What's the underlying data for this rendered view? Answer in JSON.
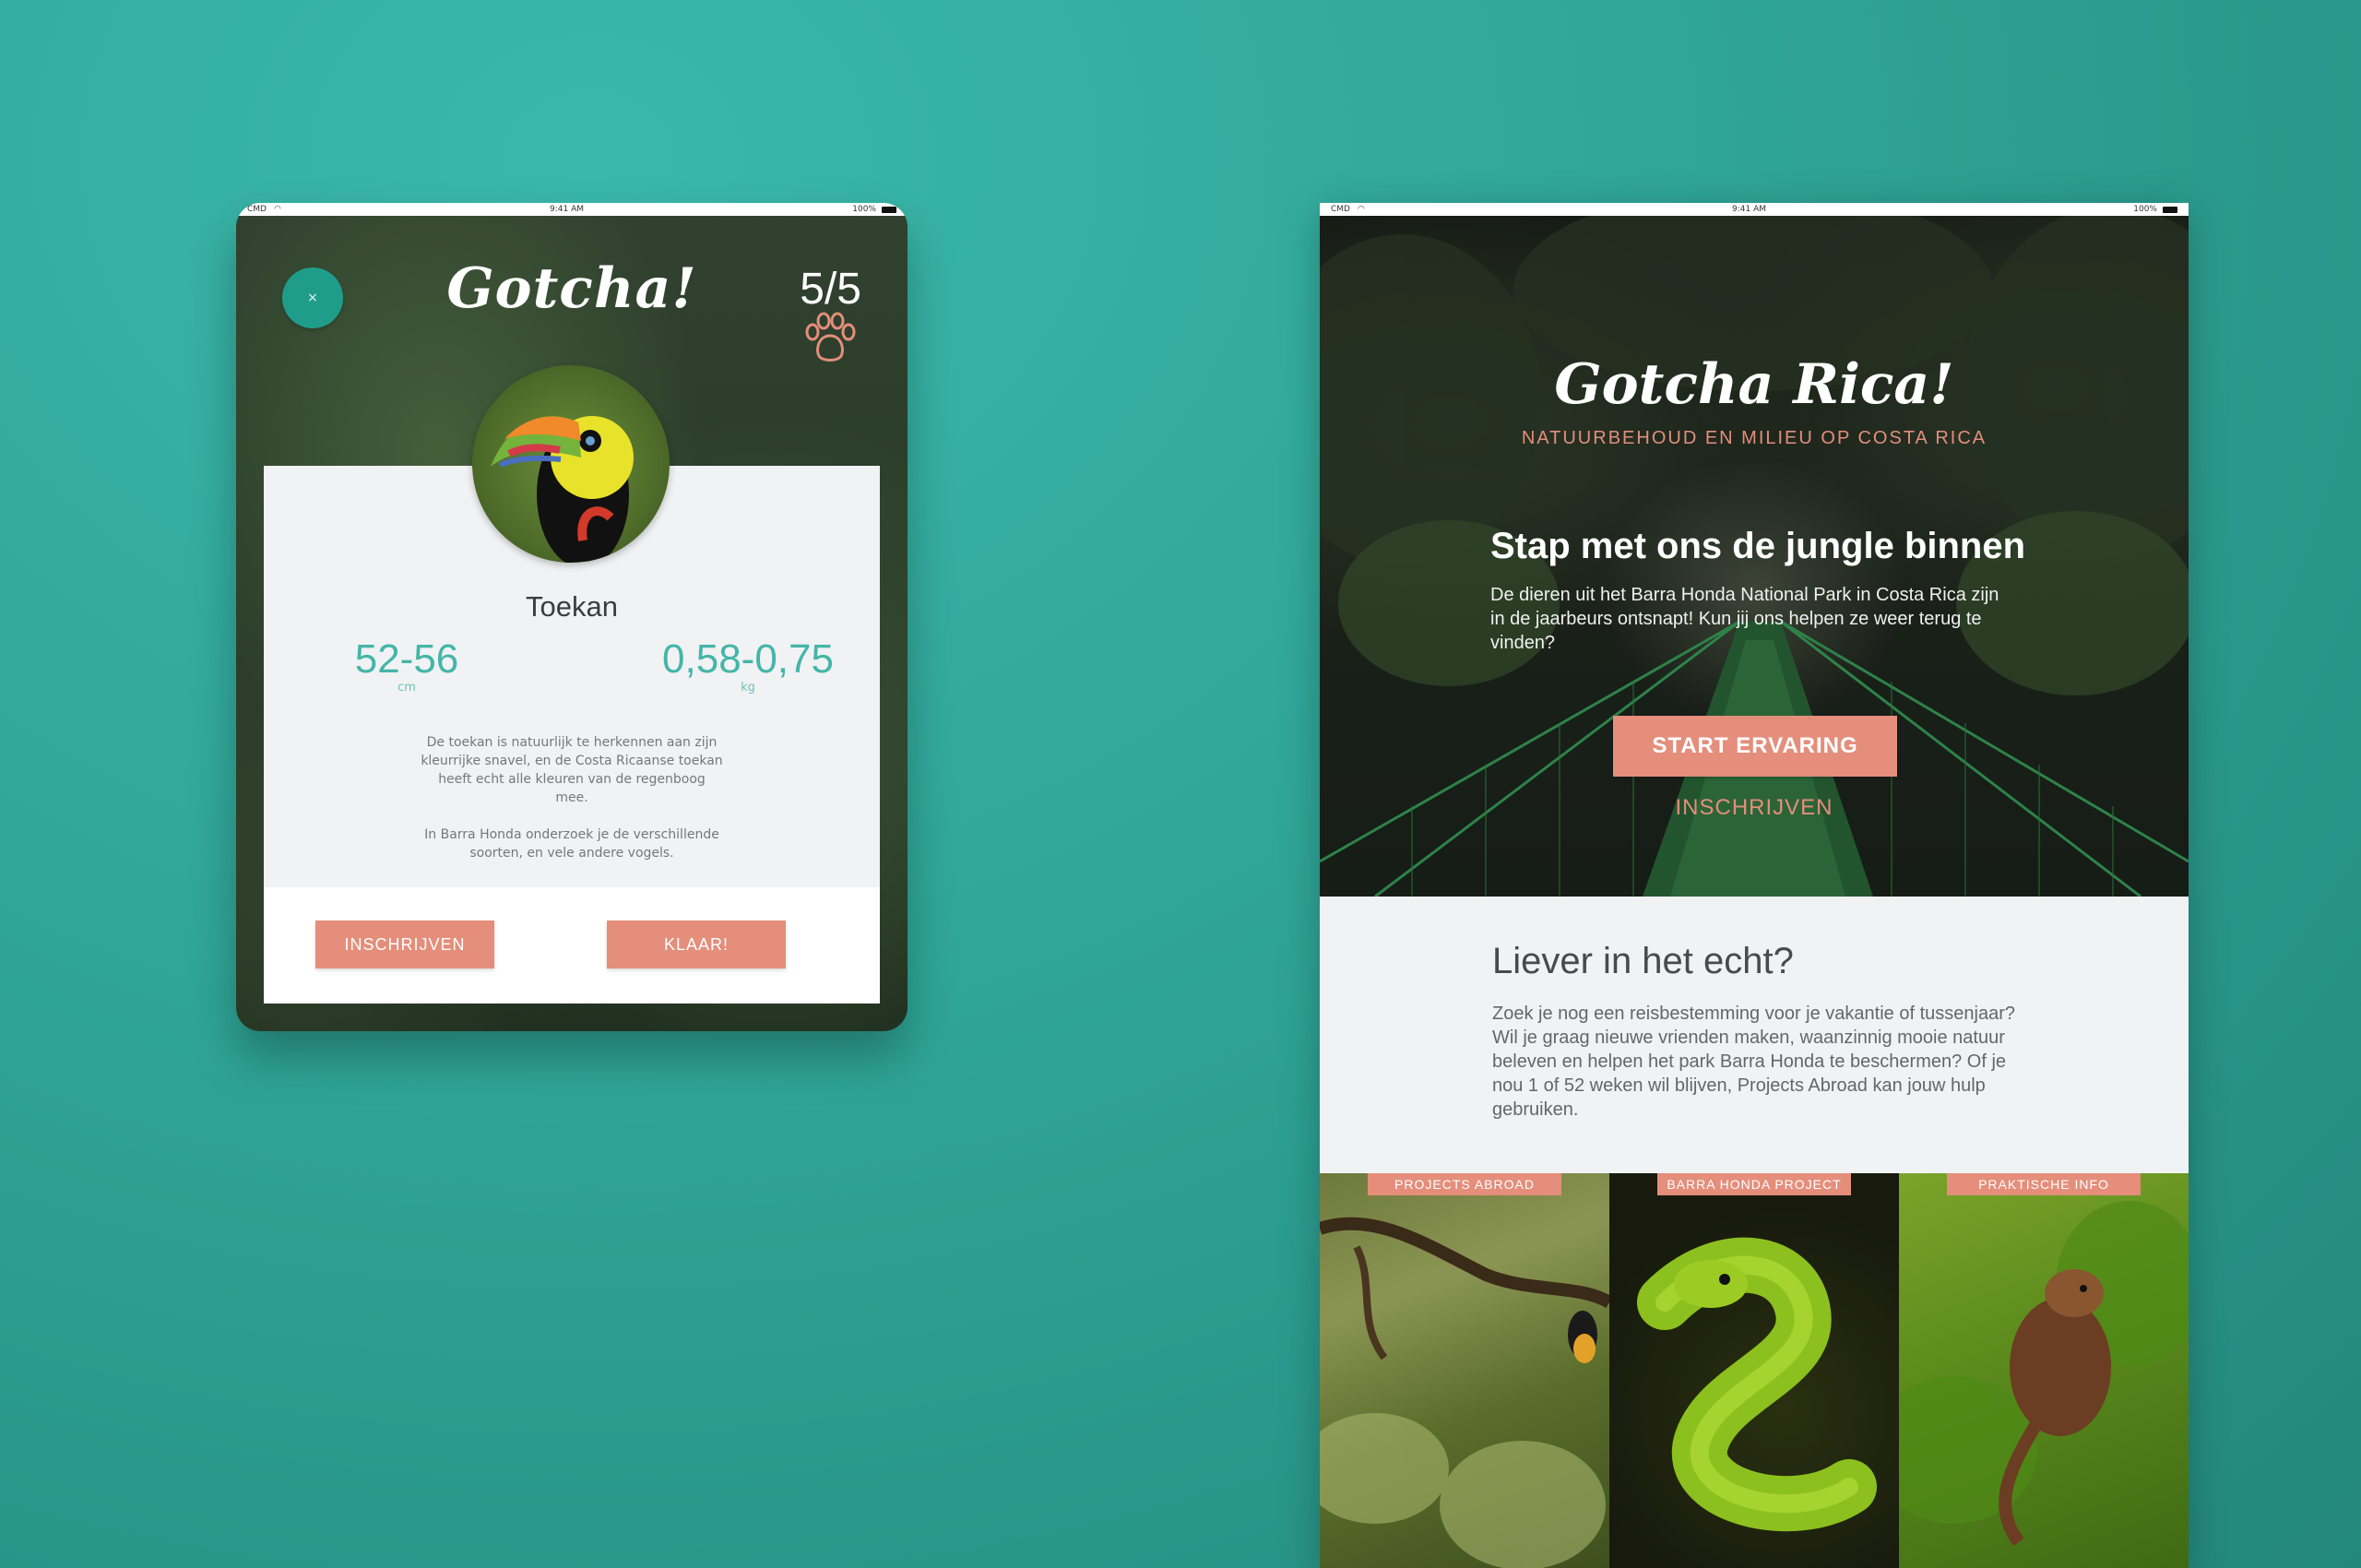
{
  "left_screen": {
    "status": {
      "carrier": "CMD",
      "time": "9:41 AM",
      "battery": "100%"
    },
    "close_label": "×",
    "logo": "Gotcha!",
    "progress": "5/5",
    "animal": {
      "name": "Toekan",
      "length_value": "52-56",
      "length_unit": "cm",
      "weight_value": "0,58-0,75",
      "weight_unit": "kg",
      "description_1": "De toekan is natuurlijk te herkennen aan zijn kleurrijke snavel, en de Costa Ricaanse toekan heeft echt alle kleuren van de regenboog mee.",
      "description_2": "In Barra Honda onderzoek je de verschillende soorten, en vele andere vogels."
    },
    "buttons": {
      "subscribe": "INSCHRIJVEN",
      "done": "KLAAR!"
    }
  },
  "right_screen": {
    "status": {
      "carrier": "CMD",
      "time": "9:41 AM",
      "battery": "100%"
    },
    "hero": {
      "logo": "Gotcha Rica!",
      "tagline": "NATUURBEHOUD EN MILIEU OP COSTA RICA",
      "title": "Stap met ons de jungle binnen",
      "text": "De dieren uit het Barra Honda National Park in Costa Rica zijn in de jaarbeurs ontsnapt! Kun jij ons helpen ze weer terug te vinden?",
      "start_button": "START ERVARING",
      "subscribe_link": "INSCHRIJVEN"
    },
    "real": {
      "title": "Liever in het echt?",
      "text": "Zoek je nog een reisbestemming voor je vakantie of tussenjaar? Wil je graag nieuwe vrienden maken, waanzinnig mooie natuur beleven en helpen het park Barra Honda te beschermen? Of je nou 1 of 52 weken wil blijven, Projects Abroad kan jouw hulp gebruiken."
    },
    "tiles": [
      {
        "label": "PROJECTS ABROAD"
      },
      {
        "label": "BARRA HONDA PROJECT"
      },
      {
        "label": "PRAKTISCHE INFO"
      }
    ]
  },
  "colors": {
    "accent_coral": "#e48e7b",
    "accent_teal": "#44b6a8",
    "background": "#2fa597"
  }
}
